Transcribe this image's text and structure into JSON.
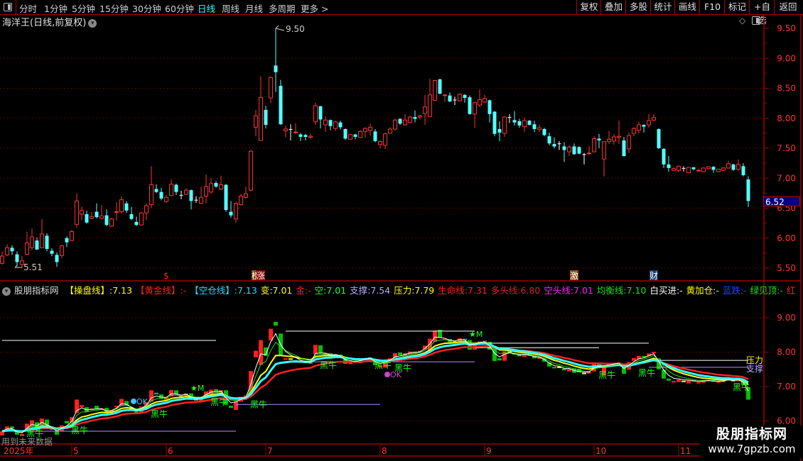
{
  "toolbar": {
    "periods": [
      "分时",
      "1分钟",
      "5分钟",
      "15分钟",
      "30分钟",
      "60分钟",
      "日线",
      "周线",
      "月线",
      "多周期",
      "更多 >"
    ],
    "active_period": "日线",
    "buttons": [
      "复权",
      "叠加",
      "多股",
      "统计",
      "画线",
      "F10",
      "标记",
      "+自选",
      "返回"
    ]
  },
  "main": {
    "title": "海洋王(日线,前复权)",
    "last_price": "6.52",
    "high_marker": "9.50",
    "low_marker": "5.51"
  },
  "indicator": {
    "name": "股朋指标网",
    "legend": [
      {
        "text": "【操盘线】:7.13",
        "color": "#ffff00"
      },
      {
        "text": "【黄金线】:-",
        "color": "#ff2020"
      },
      {
        "text": "【空仓线】:7.13",
        "color": "#20e0ff"
      },
      {
        "text": "变:7.01",
        "color": "#ffff00"
      },
      {
        "text": "金:-",
        "color": "#ff2020"
      },
      {
        "text": "空:7.01",
        "color": "#20ff20"
      },
      {
        "text": "支撑:7.54",
        "color": "#b8a8ff"
      },
      {
        "text": "压力:7.79",
        "color": "#ffff00"
      },
      {
        "text": "生命线:7.31",
        "color": "#ff2020"
      },
      {
        "text": "多头线:6.80",
        "color": "#d02828"
      },
      {
        "text": "空头线:7.01",
        "color": "#ff20ff"
      },
      {
        "text": "均衡线:7.10",
        "color": "#20e020"
      },
      {
        "text": "白买进:-",
        "color": "#ffffff"
      },
      {
        "text": "黄加仓:-",
        "color": "#ffff00"
      },
      {
        "text": "蓝跌:-",
        "color": "#2040ff"
      },
      {
        "text": "绿见顶:-",
        "color": "#20e020"
      },
      {
        "text": "红",
        "color": "#ff2020"
      }
    ],
    "future_note": "用到未来数据",
    "pressure_label": "压力",
    "support_label": "支撑",
    "signal_labels": {
      "bull": "黑牛",
      "star": "★M",
      "ok": "OK"
    }
  },
  "watermark": {
    "line1": "股朋指标网",
    "line2": "www.7gpzb.com"
  },
  "colors": {
    "up": "#ff3232",
    "down": "#54ffff",
    "grid": "#a00000",
    "axis": "#ff3232"
  },
  "chart_data": [
    {
      "type": "candlestick",
      "yticks": [
        "9.50",
        "9.00",
        "8.50",
        "8.00",
        "7.50",
        "7.00",
        "6.50",
        "6.00",
        "5.50"
      ],
      "ylim": [
        5.5,
        9.6
      ],
      "grid": true,
      "ohlc": [
        [
          5.58,
          5.78,
          5.56,
          5.7
        ],
        [
          5.72,
          5.9,
          5.7,
          5.84
        ],
        [
          5.84,
          5.88,
          5.72,
          5.78
        ],
        [
          5.73,
          5.78,
          5.53,
          5.6
        ],
        [
          5.56,
          5.7,
          5.51,
          5.62
        ],
        [
          5.73,
          6.1,
          5.72,
          5.92
        ],
        [
          5.84,
          6.16,
          5.8,
          6.02
        ],
        [
          5.96,
          6.01,
          5.8,
          5.81
        ],
        [
          5.84,
          6.32,
          5.83,
          6.07
        ],
        [
          6.04,
          6.08,
          5.78,
          5.82
        ],
        [
          5.79,
          5.83,
          5.7,
          5.74
        ],
        [
          5.72,
          5.76,
          5.52,
          5.6
        ],
        [
          5.71,
          5.89,
          5.66,
          5.87
        ],
        [
          6.0,
          6.03,
          5.85,
          5.93
        ],
        [
          5.96,
          6.14,
          5.95,
          6.11
        ],
        [
          6.23,
          6.75,
          6.17,
          6.62
        ],
        [
          6.4,
          6.52,
          6.3,
          6.46
        ],
        [
          6.4,
          6.46,
          6.24,
          6.26
        ],
        [
          6.33,
          6.44,
          6.31,
          6.36
        ],
        [
          6.44,
          6.58,
          6.33,
          6.35
        ],
        [
          6.33,
          6.55,
          6.31,
          6.37
        ],
        [
          6.38,
          6.48,
          6.2,
          6.22
        ],
        [
          6.2,
          6.34,
          6.19,
          6.32
        ],
        [
          6.43,
          6.6,
          6.3,
          6.44
        ],
        [
          6.44,
          6.7,
          6.41,
          6.64
        ],
        [
          6.58,
          6.62,
          6.42,
          6.46
        ],
        [
          6.4,
          6.52,
          6.3,
          6.32
        ],
        [
          6.27,
          6.36,
          6.2,
          6.22
        ],
        [
          6.22,
          6.44,
          6.21,
          6.42
        ],
        [
          6.42,
          6.58,
          6.3,
          6.54
        ],
        [
          6.56,
          7.2,
          6.5,
          6.89
        ],
        [
          6.82,
          6.9,
          6.75,
          6.77
        ],
        [
          6.77,
          6.84,
          6.63,
          6.66
        ],
        [
          6.61,
          6.72,
          6.59,
          6.68
        ],
        [
          6.71,
          6.98,
          6.7,
          6.9
        ],
        [
          6.89,
          6.91,
          6.72,
          6.77
        ],
        [
          6.72,
          6.79,
          6.65,
          6.72
        ],
        [
          6.73,
          6.83,
          6.72,
          6.8
        ],
        [
          6.8,
          6.81,
          6.48,
          6.62
        ],
        [
          6.64,
          6.7,
          6.59,
          6.64
        ],
        [
          6.58,
          6.86,
          6.57,
          6.68
        ],
        [
          6.7,
          7.06,
          6.58,
          6.86
        ],
        [
          6.77,
          7.0,
          6.74,
          6.91
        ],
        [
          6.92,
          6.95,
          6.84,
          6.86
        ],
        [
          6.82,
          7.04,
          6.8,
          6.89
        ],
        [
          6.89,
          6.9,
          6.44,
          6.47
        ],
        [
          6.44,
          6.62,
          6.34,
          6.38
        ],
        [
          6.32,
          6.6,
          6.26,
          6.58
        ],
        [
          6.56,
          6.74,
          6.54,
          6.7
        ],
        [
          6.68,
          6.86,
          6.66,
          6.74
        ],
        [
          6.8,
          7.47,
          6.78,
          7.45
        ],
        [
          7.85,
          8.14,
          7.7,
          8.04
        ],
        [
          7.63,
          8.7,
          7.63,
          8.35
        ],
        [
          8.14,
          8.21,
          7.83,
          7.89
        ],
        [
          8.34,
          8.7,
          8.25,
          8.68
        ],
        [
          8.88,
          9.5,
          8.44,
          8.77
        ],
        [
          8.54,
          8.64,
          7.89,
          7.9
        ],
        [
          7.79,
          7.88,
          7.68,
          7.82
        ],
        [
          7.82,
          7.9,
          7.63,
          7.82
        ],
        [
          7.76,
          7.92,
          7.74,
          7.77
        ],
        [
          7.73,
          7.75,
          7.62,
          7.69
        ],
        [
          7.72,
          7.74,
          7.63,
          7.69
        ],
        [
          7.68,
          7.74,
          7.66,
          7.7
        ],
        [
          7.94,
          8.26,
          7.89,
          8.21
        ],
        [
          8.2,
          8.21,
          7.83,
          7.98
        ],
        [
          7.89,
          8.03,
          7.77,
          7.97
        ],
        [
          7.97,
          7.98,
          7.8,
          7.87
        ],
        [
          7.83,
          7.96,
          7.79,
          7.94
        ],
        [
          7.93,
          7.96,
          7.81,
          7.85
        ],
        [
          7.82,
          7.83,
          7.64,
          7.66
        ],
        [
          7.65,
          7.74,
          7.64,
          7.73
        ],
        [
          7.73,
          7.74,
          7.65,
          7.69
        ],
        [
          7.68,
          7.8,
          7.67,
          7.78
        ],
        [
          7.78,
          7.85,
          7.68,
          7.83
        ],
        [
          7.8,
          7.91,
          7.71,
          7.85
        ],
        [
          7.78,
          7.82,
          7.6,
          7.62
        ],
        [
          7.56,
          7.63,
          7.5,
          7.61
        ],
        [
          7.55,
          7.76,
          7.49,
          7.74
        ],
        [
          7.75,
          7.85,
          7.74,
          7.82
        ],
        [
          7.82,
          7.99,
          7.8,
          7.97
        ],
        [
          7.99,
          8.0,
          7.89,
          7.91
        ],
        [
          7.89,
          8.07,
          7.88,
          7.97
        ],
        [
          7.93,
          8.04,
          7.92,
          8.02
        ],
        [
          8.02,
          8.13,
          7.93,
          7.99
        ],
        [
          8.02,
          8.06,
          7.98,
          8.04
        ],
        [
          8.08,
          8.39,
          7.89,
          8.19
        ],
        [
          8.03,
          8.66,
          8.03,
          8.39
        ],
        [
          8.3,
          8.64,
          8.29,
          8.63
        ],
        [
          8.65,
          8.66,
          8.4,
          8.41
        ],
        [
          8.38,
          8.4,
          8.27,
          8.39
        ],
        [
          8.38,
          8.43,
          8.27,
          8.28
        ],
        [
          8.31,
          8.36,
          8.22,
          8.31
        ],
        [
          8.29,
          8.42,
          8.28,
          8.4
        ],
        [
          8.39,
          8.4,
          8.26,
          8.34
        ],
        [
          8.35,
          8.38,
          8.06,
          8.07
        ],
        [
          8.07,
          8.28,
          7.84,
          8.26
        ],
        [
          8.22,
          8.48,
          8.19,
          8.31
        ],
        [
          8.27,
          8.39,
          8.26,
          8.33
        ],
        [
          8.3,
          8.31,
          7.93,
          8.07
        ],
        [
          8.11,
          8.12,
          7.7,
          7.74
        ],
        [
          7.82,
          7.95,
          7.62,
          7.76
        ],
        [
          7.75,
          8.03,
          7.69,
          8.02
        ],
        [
          8.02,
          8.07,
          7.92,
          8.02
        ],
        [
          7.97,
          8.12,
          7.88,
          7.93
        ],
        [
          7.95,
          7.99,
          7.84,
          7.88
        ],
        [
          7.86,
          8.01,
          7.77,
          7.96
        ],
        [
          7.96,
          7.97,
          7.88,
          7.89
        ],
        [
          7.9,
          7.96,
          7.77,
          7.82
        ],
        [
          7.81,
          7.89,
          7.77,
          7.84
        ],
        [
          7.82,
          7.84,
          7.7,
          7.72
        ],
        [
          7.7,
          7.76,
          7.55,
          7.58
        ],
        [
          7.57,
          7.68,
          7.5,
          7.53
        ],
        [
          7.58,
          7.62,
          7.47,
          7.58
        ],
        [
          7.53,
          7.6,
          7.27,
          7.47
        ],
        [
          7.44,
          7.55,
          7.37,
          7.52
        ],
        [
          7.53,
          7.58,
          7.39,
          7.4
        ],
        [
          7.52,
          7.53,
          7.4,
          7.41
        ],
        [
          7.4,
          7.42,
          7.23,
          7.4
        ],
        [
          7.41,
          7.54,
          7.39,
          7.42
        ],
        [
          7.44,
          7.7,
          7.43,
          7.66
        ],
        [
          7.66,
          7.74,
          7.5,
          7.63
        ],
        [
          7.32,
          7.61,
          7.03,
          7.61
        ],
        [
          7.61,
          7.79,
          7.57,
          7.65
        ],
        [
          7.62,
          7.74,
          7.56,
          7.69
        ],
        [
          7.68,
          7.96,
          7.57,
          7.7
        ],
        [
          7.63,
          7.69,
          7.36,
          7.37
        ],
        [
          7.49,
          7.76,
          7.42,
          7.71
        ],
        [
          7.75,
          7.85,
          7.7,
          7.83
        ],
        [
          7.8,
          7.94,
          7.75,
          7.89
        ],
        [
          7.89,
          7.9,
          7.76,
          7.86
        ],
        [
          7.89,
          8.07,
          7.84,
          7.96
        ],
        [
          7.97,
          8.07,
          7.95,
          8.01
        ],
        [
          7.82,
          7.83,
          7.49,
          7.5
        ],
        [
          7.49,
          7.5,
          7.17,
          7.23
        ],
        [
          7.23,
          7.37,
          7.11,
          7.17
        ],
        [
          7.13,
          7.18,
          7.12,
          7.16
        ],
        [
          7.13,
          7.21,
          7.1,
          7.2
        ],
        [
          7.17,
          7.2,
          7.11,
          7.17
        ],
        [
          7.09,
          7.19,
          7.08,
          7.18
        ],
        [
          7.18,
          7.19,
          7.13,
          7.15
        ],
        [
          7.12,
          7.16,
          7.11,
          7.13
        ],
        [
          7.11,
          7.18,
          7.1,
          7.17
        ],
        [
          7.16,
          7.2,
          7.15,
          7.19
        ],
        [
          7.19,
          7.2,
          7.09,
          7.14
        ],
        [
          7.11,
          7.16,
          7.1,
          7.15
        ],
        [
          7.13,
          7.19,
          7.12,
          7.17
        ],
        [
          7.17,
          7.29,
          7.16,
          7.24
        ],
        [
          7.23,
          7.24,
          7.12,
          7.14
        ],
        [
          7.15,
          7.31,
          7.12,
          7.23
        ],
        [
          7.2,
          7.25,
          7.03,
          7.05
        ],
        [
          6.98,
          7.03,
          6.52,
          6.62
        ]
      ],
      "high_index": 55,
      "low_index": 4,
      "badges": [
        {
          "index": 33,
          "text": "$",
          "color": "#ff2020",
          "bg": "none"
        },
        {
          "index": 51,
          "text": "榜",
          "color": "#ffffff",
          "bg": "#8b4a10"
        },
        {
          "index": 52,
          "text": "涨",
          "color": "#ffffff",
          "bg": "#8b0000"
        },
        {
          "index": 115,
          "text": "激",
          "color": "#ffffff",
          "bg": "#8b4a10"
        },
        {
          "index": 131,
          "text": "财",
          "color": "#ffffff",
          "bg": "#104070"
        }
      ],
      "xticks": [
        {
          "index": 0,
          "label": "2025年"
        },
        {
          "index": 14,
          "label": "5"
        },
        {
          "index": 33,
          "label": "6"
        },
        {
          "index": 53,
          "label": "7"
        },
        {
          "index": 76,
          "label": "8"
        },
        {
          "index": 97,
          "label": "9"
        },
        {
          "index": 119,
          "label": "10"
        },
        {
          "index": 136,
          "label": "11"
        }
      ]
    },
    {
      "type": "indicator",
      "yticks": [
        "9.00",
        "8.00",
        "7.00",
        "6.00"
      ],
      "ylim": [
        5.6,
        9.4
      ],
      "levels": [
        {
          "value": 8.34,
          "from": 0,
          "to": 43,
          "color": "#ffffff"
        },
        {
          "value": 5.7,
          "from": 0,
          "to": 47,
          "color": "#b090ff"
        },
        {
          "value": 6.48,
          "from": 47,
          "to": 76,
          "color": "#b090ff"
        },
        {
          "value": 8.61,
          "from": 57,
          "to": 95,
          "color": "#ffffff"
        },
        {
          "value": 7.72,
          "from": 57,
          "to": 95,
          "color": "#b090ff"
        },
        {
          "value": 8.26,
          "from": 95,
          "to": 130,
          "color": "#ffffff"
        },
        {
          "value": 8.13,
          "from": 95,
          "to": 120,
          "color": "#ffffff"
        },
        {
          "value": 7.76,
          "from": 130,
          "to": 150,
          "color": "#ffffff",
          "label": "pressure"
        },
        {
          "value": 7.56,
          "from": 130,
          "to": 150,
          "color": "#b090ff",
          "label": "support"
        }
      ],
      "signals": [
        {
          "type": "bull",
          "index": 6,
          "value": 5.66
        },
        {
          "type": "bull",
          "index": 15,
          "value": 5.74
        },
        {
          "type": "bull",
          "index": 31,
          "value": 6.22
        },
        {
          "type": "bull",
          "index": 43,
          "value": 6.57
        },
        {
          "type": "bull",
          "index": 51,
          "value": 6.5
        },
        {
          "type": "bull",
          "index": 65,
          "value": 7.64
        },
        {
          "type": "bull",
          "index": 76,
          "value": 7.64
        },
        {
          "type": "bull",
          "index": 80,
          "value": 7.56
        },
        {
          "type": "bull",
          "index": 121,
          "value": 7.35
        },
        {
          "type": "bull",
          "index": 129,
          "value": 7.41
        },
        {
          "type": "bull",
          "index": 148,
          "value": 7.0
        },
        {
          "type": "star",
          "index": 39,
          "value": 6.96
        },
        {
          "type": "star",
          "index": 95,
          "value": 8.53
        },
        {
          "type": "ok",
          "index": 27,
          "value": 6.57,
          "color": "#40c0ff"
        },
        {
          "type": "ok",
          "index": 78,
          "value": 7.35,
          "color": "#d040d0"
        }
      ],
      "lines": [
        {
          "color": "#ff2020",
          "period": 21
        },
        {
          "color": "#ffff00",
          "period": 9
        },
        {
          "color": "#30ffff",
          "period": 13
        },
        {
          "color": "#20e020",
          "period": 5
        },
        {
          "color": "#ffffff",
          "period": 3
        }
      ]
    }
  ]
}
